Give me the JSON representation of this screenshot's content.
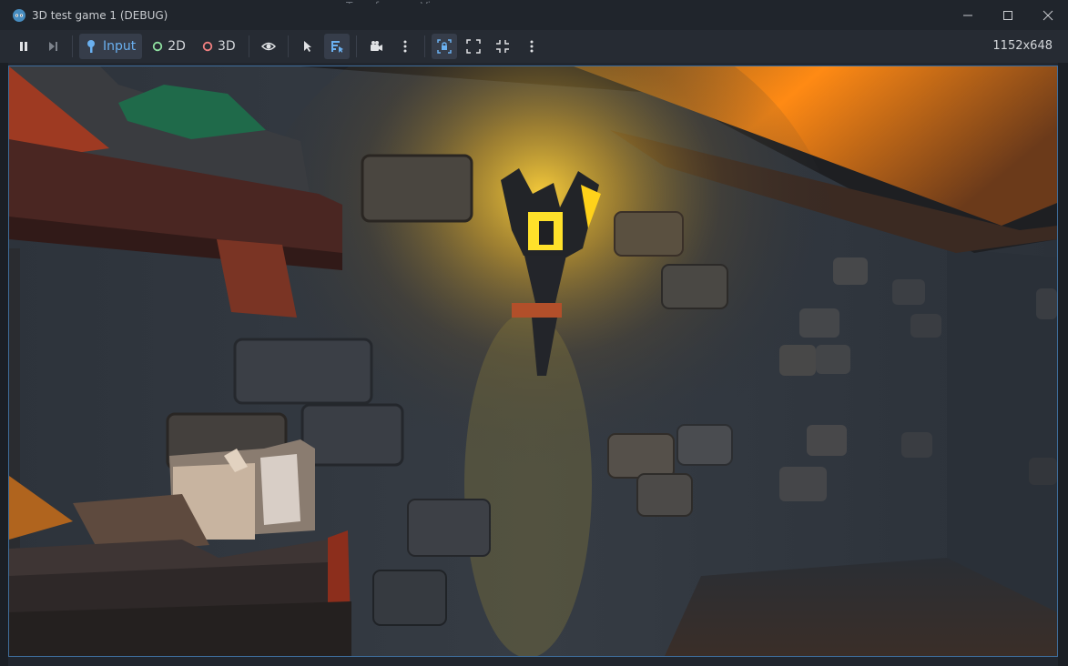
{
  "window": {
    "title": "3D test game 1 (DEBUG)",
    "icon": "godot-icon",
    "background_menu": [
      "Transform",
      "View"
    ]
  },
  "toolbar": {
    "input_label": "Input",
    "mode_2d_label": "2D",
    "mode_3d_label": "3D",
    "resolution": "1152x648"
  },
  "colors": {
    "accent": "#6ab0f0",
    "dot_2d": "#8fe0a0",
    "dot_3d": "#f08080",
    "viewport_border": "#3f6e9c"
  }
}
